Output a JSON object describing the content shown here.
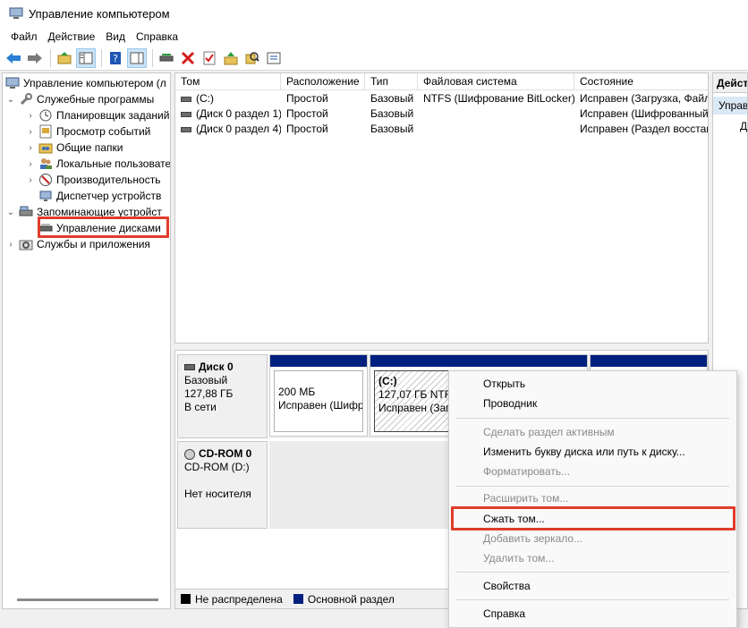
{
  "window": {
    "title": "Управление компьютером"
  },
  "menu": [
    "Файл",
    "Действие",
    "Вид",
    "Справка"
  ],
  "toolbar": [
    "back-icon",
    "forward-icon",
    "up-folder-icon",
    "show-tree-icon",
    "help-icon",
    "properties-icon",
    "connect-icon",
    "delete-icon",
    "check-icon",
    "rescan-icon",
    "search-icon",
    "list-icon"
  ],
  "tree": {
    "root": "Управление компьютером (л",
    "system_tools": "Служебные программы",
    "task_scheduler": "Планировщик заданий",
    "event_viewer": "Просмотр событий",
    "shared_folders": "Общие папки",
    "local_users": "Локальные пользовате",
    "performance": "Производительность",
    "device_manager": "Диспетчер устройств",
    "storage": "Запоминающие устройст",
    "disk_management": "Управление дисками",
    "services": "Службы и приложения"
  },
  "list": {
    "columns": [
      "Том",
      "Расположение",
      "Тип",
      "Файловая система",
      "Состояние"
    ],
    "rows": [
      [
        "(C:)",
        "Простой",
        "Базовый",
        "NTFS (Шифрование BitLocker)",
        "Исправен (Загрузка, Файл"
      ],
      [
        "(Диск 0 раздел 1)",
        "Простой",
        "Базовый",
        "",
        "Исправен (Шифрованный"
      ],
      [
        "(Диск 0 раздел 4)",
        "Простой",
        "Базовый",
        "",
        "Исправен (Раздел восстан"
      ]
    ]
  },
  "disk0": {
    "name": "Диск 0",
    "type": "Базовый",
    "size": "127,88 ГБ",
    "status": "В сети",
    "part1": {
      "size": "200 МБ",
      "status": "Исправен (Шифр"
    },
    "part2": {
      "label": "(C:)",
      "size": "127,07 ГБ NTFS",
      "status": "Исправен (Загр"
    }
  },
  "cdrom": {
    "name": "CD-ROM 0",
    "drive": "CD-ROM (D:)",
    "status": "Нет носителя"
  },
  "legend": {
    "unallocated": "Не распределена",
    "primary": "Основной раздел",
    "unallocated_color": "#000000",
    "primary_color": "#00207f"
  },
  "actions": {
    "title": "Действия",
    "section": "Управление дисками",
    "item": "Дополнительные действия"
  },
  "context_menu": {
    "open": "Открыть",
    "explorer": "Проводник",
    "make_active": "Сделать раздел активным",
    "change_letter": "Изменить букву диска или путь к диску...",
    "format": "Форматировать...",
    "extend": "Расширить том...",
    "shrink": "Сжать том...",
    "add_mirror": "Добавить зеркало...",
    "delete": "Удалить том...",
    "properties": "Свойства",
    "help": "Справка"
  },
  "colors": {
    "highlight": "#e03c2c",
    "selection": "#dbe8f5"
  }
}
